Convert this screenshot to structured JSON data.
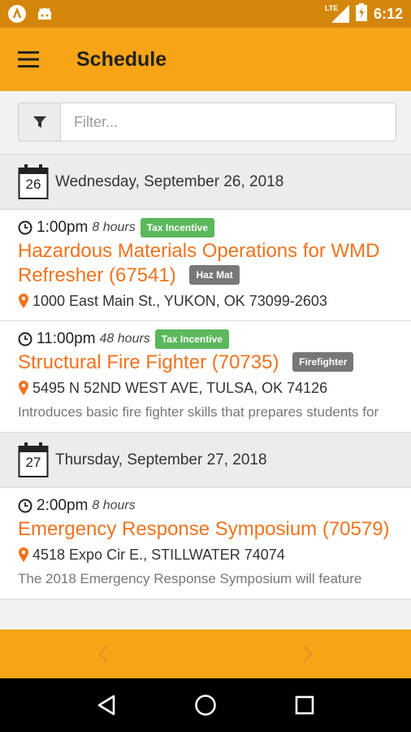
{
  "status_bar": {
    "network_label": "LTE",
    "time": "6:12",
    "left_icons": [
      "app-notification-icon",
      "android-notification-icon"
    ],
    "right_icons": [
      "signal-icon",
      "battery-charging-icon"
    ]
  },
  "app_bar": {
    "title": "Schedule",
    "menu_icon": "hamburger-menu-icon"
  },
  "filter": {
    "placeholder": "Filter...",
    "value": "",
    "icon": "filter-icon"
  },
  "days": [
    {
      "day_number": "26",
      "label": "Wednesday, September 26, 2018",
      "events": [
        {
          "time": "1:00pm",
          "duration": "8 hours",
          "badge": "Tax Incentive",
          "title": "Hazardous Materials Operations for WMD Refresher (67541)",
          "category": "Haz Mat",
          "location": "1000 East Main St., YUKON, OK 73099-2603",
          "description": ""
        },
        {
          "time": "11:00pm",
          "duration": "48 hours",
          "badge": "Tax Incentive",
          "title": "Structural Fire Fighter (70735)",
          "category": "Firefighter",
          "location": "5495 N 52ND WEST AVE, TULSA, OK 74126",
          "description": "Introduces basic fire fighter skills that prepares students for"
        }
      ]
    },
    {
      "day_number": "27",
      "label": "Thursday, September 27, 2018",
      "events": [
        {
          "time": "2:00pm",
          "duration": "8 hours",
          "badge": "",
          "title": "Emergency Response Symposium (70579)",
          "category": "",
          "location": "4518 Expo Cir E., STILLWATER 74074",
          "description": "The 2018 Emergency Response Symposium will feature"
        }
      ]
    }
  ],
  "pager": {
    "prev_icon": "chevron-left-icon",
    "next_icon": "chevron-right-icon"
  },
  "nav_bar": {
    "icons": [
      "back-triangle-icon",
      "home-circle-icon",
      "recents-square-icon"
    ]
  },
  "colors": {
    "status_bar": "#d4860a",
    "app_bar": "#f7a416",
    "title_link": "#f0731e",
    "badge_green": "#5cb85c",
    "badge_gray": "#777777"
  }
}
